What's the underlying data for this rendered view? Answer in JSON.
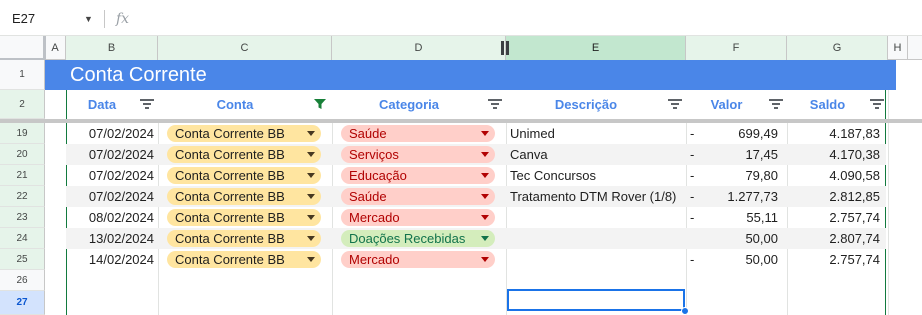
{
  "formula_bar": {
    "name_box": "E27",
    "fx": "fx",
    "formula": ""
  },
  "columns": [
    "A",
    "B",
    "C",
    "D",
    "E",
    "F",
    "G",
    "H"
  ],
  "row_numbers": [
    "1",
    "2",
    "19",
    "20",
    "21",
    "22",
    "23",
    "24",
    "25",
    "26",
    "27"
  ],
  "title": "Conta Corrente",
  "headers": {
    "data": "Data",
    "conta": "Conta",
    "categoria": "Categoria",
    "descricao": "Descrição",
    "valor": "Valor",
    "saldo": "Saldo"
  },
  "rows": [
    {
      "date": "07/02/2024",
      "conta": "Conta Corrente BB",
      "categoria": "Saúde",
      "cat_color": "red",
      "descricao": "Unimed",
      "dash": "-",
      "valor": "699,49",
      "saldo": "4.187,83"
    },
    {
      "date": "07/02/2024",
      "conta": "Conta Corrente BB",
      "categoria": "Serviços",
      "cat_color": "red",
      "descricao": "Canva",
      "dash": "-",
      "valor": "17,45",
      "saldo": "4.170,38"
    },
    {
      "date": "07/02/2024",
      "conta": "Conta Corrente BB",
      "categoria": "Educação",
      "cat_color": "red",
      "descricao": "Tec Concursos",
      "dash": "-",
      "valor": "79,80",
      "saldo": "4.090,58"
    },
    {
      "date": "07/02/2024",
      "conta": "Conta Corrente BB",
      "categoria": "Saúde",
      "cat_color": "red",
      "descricao": "Tratamento DTM Rover (1/8)",
      "dash": "-",
      "valor": "1.277,73",
      "saldo": "2.812,85"
    },
    {
      "date": "08/02/2024",
      "conta": "Conta Corrente BB",
      "categoria": "Mercado",
      "cat_color": "red",
      "descricao": "",
      "dash": "-",
      "valor": "55,11",
      "saldo": "2.757,74"
    },
    {
      "date": "13/02/2024",
      "conta": "Conta Corrente BB",
      "categoria": "Doações Recebidas",
      "cat_color": "green",
      "descricao": "",
      "dash": "",
      "valor": "50,00",
      "saldo": "2.807,74"
    },
    {
      "date": "14/02/2024",
      "conta": "Conta Corrente BB",
      "categoria": "Mercado",
      "cat_color": "red",
      "descricao": "",
      "dash": "-",
      "valor": "50,00",
      "saldo": "2.757,74"
    }
  ],
  "colors": {
    "title_bg": "#4a86e8",
    "header_text": "#4a86e8",
    "table_border": "#127a3e",
    "selection": "#1a73e8"
  }
}
